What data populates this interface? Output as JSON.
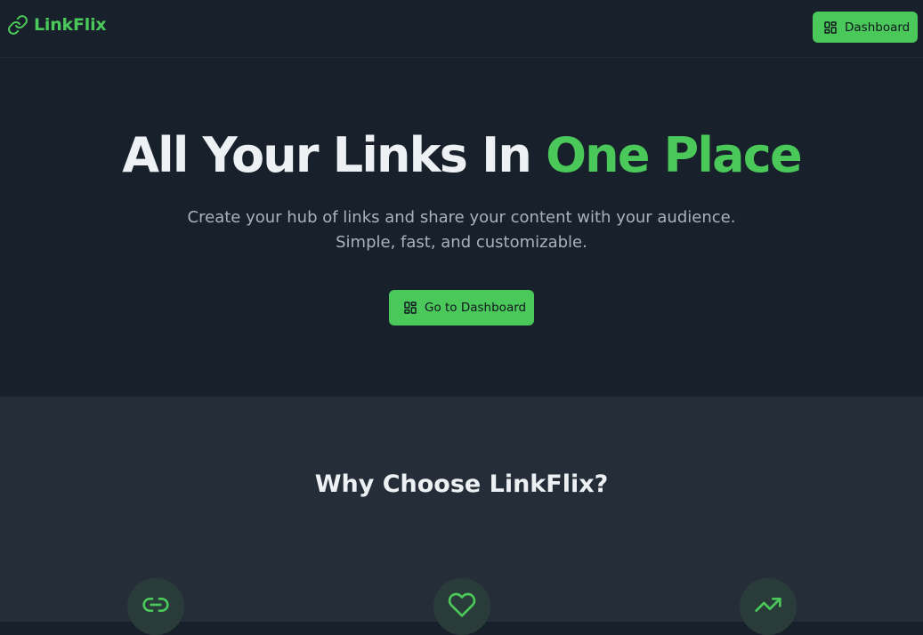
{
  "header": {
    "brand": "LinkFlix",
    "dashboard_label": "Dashboard"
  },
  "hero": {
    "title_main": "All Your Links In ",
    "title_accent": "One Place",
    "subtitle_line1": "Create your hub of links and share your content with your audience.",
    "subtitle_line2": "Simple, fast, and customizable.",
    "cta_label": "Go to Dashboard"
  },
  "features": {
    "title": "Why Choose LinkFlix?",
    "icons": [
      "link-icon",
      "heart-icon",
      "trending-up-icon"
    ]
  },
  "colors": {
    "accent": "#4bc85a",
    "background": "#18212b",
    "section_background": "#242d38",
    "icon_circle": "#2a3c3a"
  }
}
